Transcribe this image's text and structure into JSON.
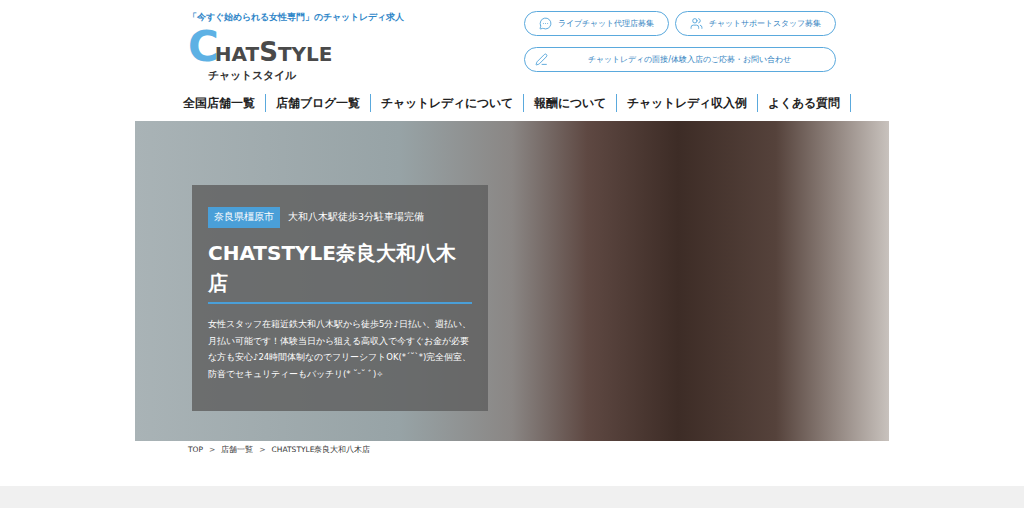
{
  "header": {
    "tagline": "「今すぐ始められる女性専門」のチャットレディ求人",
    "logo": {
      "parts": [
        {
          "text": "C",
          "big": true,
          "accent": true
        },
        {
          "text": "HAT",
          "big": false,
          "accent": false
        },
        {
          "text": "S",
          "big": true,
          "accent": false
        },
        {
          "text": "TYLE",
          "big": false,
          "accent": false
        }
      ],
      "kana": "チャットスタイル"
    },
    "buttons": [
      {
        "label": "ライブチャット代理店募集",
        "kind": "chat"
      },
      {
        "label": "チャットサポートスタッフ募集",
        "kind": "staff"
      }
    ],
    "contact": {
      "label": "チャットレディの面接/体験入店のご応募・お問い合わせ",
      "kind": "pen"
    }
  },
  "nav": [
    "全国店舗一覧",
    "店舗ブログ一覧",
    "チャットレディについて",
    "報酬について",
    "チャットレディ収入例",
    "よくある質問"
  ],
  "hero": {
    "tag": "奈良県橿原市",
    "access": "大和八木駅徒歩3分駐車場完備",
    "title": "CHATSTYLE奈良大和八木店",
    "description": "女性スタッフ在籍近鉄大和八木駅から徒歩5分♪日払い、週払い、月払い可能です！体験当日から狙える高収入で今すぐお金が必要な方も安心♪24時間体制なのでフリーシフトOK(*´˘`*)完全個室、防音でセキュリティーもバッチリ(* ˘ᵕ˘ ﾞ)✧"
  },
  "breadcrumb": {
    "separator": ">",
    "items": [
      "TOP",
      "店舗一覧",
      "CHATSTYLE奈良大和八木店"
    ]
  }
}
